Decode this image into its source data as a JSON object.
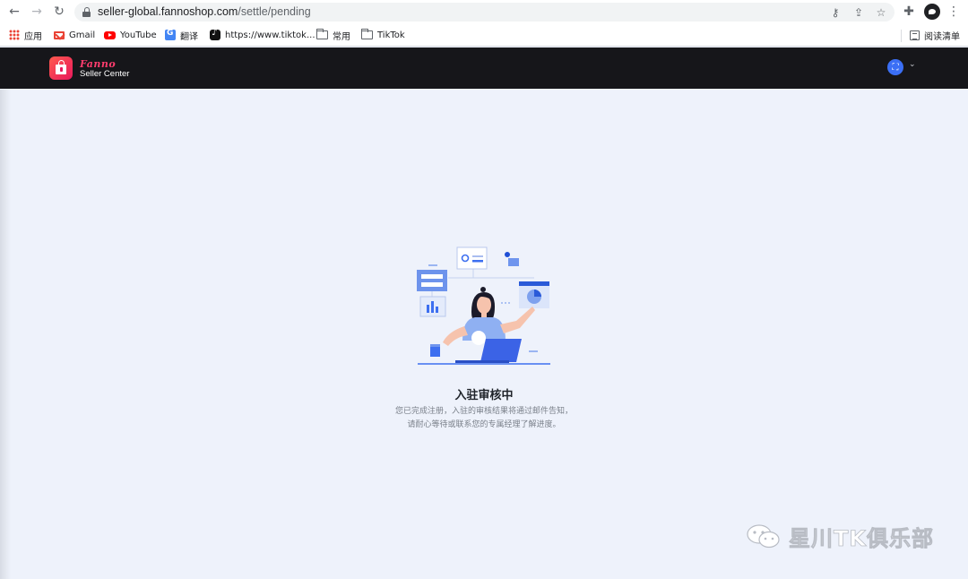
{
  "browser": {
    "url_host": "seller-global.fannoshop.com",
    "url_path": "/settle/pending",
    "bookmarks": [
      {
        "label": "应用",
        "icon": "apps-grid-icon"
      },
      {
        "label": "Gmail",
        "icon": "gmail-icon"
      },
      {
        "label": "YouTube",
        "icon": "youtube-icon"
      },
      {
        "label": "翻译",
        "icon": "translate-icon"
      },
      {
        "label": "https://www.tiktok...",
        "icon": "tiktok-icon"
      },
      {
        "label": "常用",
        "icon": "folder-icon"
      },
      {
        "label": "TikTok",
        "icon": "folder-icon"
      }
    ],
    "reading_list": "阅读清单"
  },
  "header": {
    "brand": "Fanno",
    "subtitle": "Seller Center",
    "avatar_glyph": "⛶",
    "caret": "⌄"
  },
  "main": {
    "title": "入驻审核中",
    "description_line1": "您已完成注册，入驻的审核结果将通过邮件告知，",
    "description_line2": "请耐心等待或联系您的专属经理了解进度。"
  },
  "watermark": {
    "text": "星川TK俱乐部"
  },
  "colors": {
    "accent": "#3b6ff5",
    "header_bg": "#16161a",
    "page_bg": "#eef2fb",
    "brand": "#ff3d6e"
  }
}
